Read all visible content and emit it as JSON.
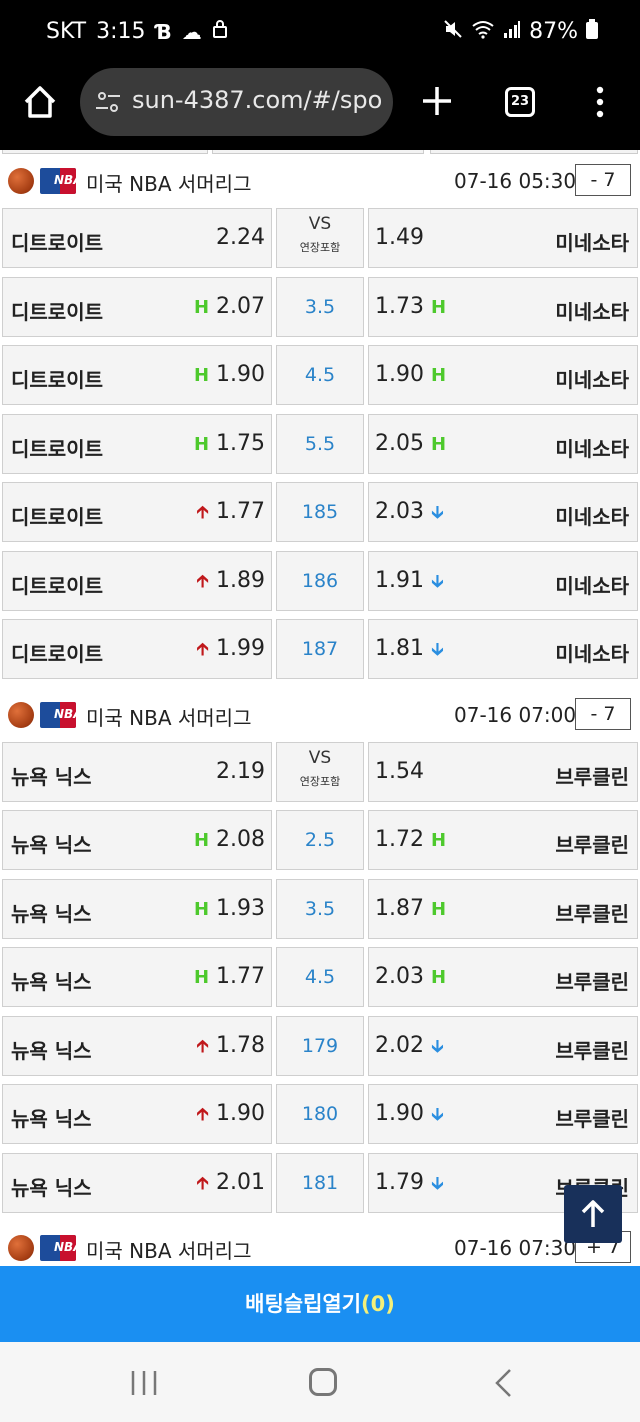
{
  "status_bar": {
    "carrier": "SKT",
    "time": "3:15",
    "battery": "87%",
    "icons": [
      "b-app-icon",
      "cloud-icon",
      "lock-icon",
      "mute-icon",
      "wifi-icon",
      "signal-icon",
      "battery-icon"
    ]
  },
  "browser": {
    "url": "sun-4387.com/#/spo",
    "tab_count": "23"
  },
  "leagues": [
    {
      "name": "미국 NBA 서머리그",
      "time": "07-16 05:30",
      "more": "- 7",
      "vs_label": "VS",
      "vs_sub": "연장포함",
      "rows": [
        {
          "home": "디트로이트",
          "home_odd": "2.24",
          "mid": "VS",
          "away_odd": "1.49",
          "away": "미네소타",
          "type": "moneyline"
        },
        {
          "home": "디트로이트",
          "home_odd": "2.07",
          "mid": "3.5",
          "away_odd": "1.73",
          "away": "미네소타",
          "type": "handicap",
          "marker": "H"
        },
        {
          "home": "디트로이트",
          "home_odd": "1.90",
          "mid": "4.5",
          "away_odd": "1.90",
          "away": "미네소타",
          "type": "handicap",
          "marker": "H"
        },
        {
          "home": "디트로이트",
          "home_odd": "1.75",
          "mid": "5.5",
          "away_odd": "2.05",
          "away": "미네소타",
          "type": "handicap",
          "marker": "H"
        },
        {
          "home": "디트로이트",
          "home_odd": "1.77",
          "mid": "185",
          "away_odd": "2.03",
          "away": "미네소타",
          "type": "overunder"
        },
        {
          "home": "디트로이트",
          "home_odd": "1.89",
          "mid": "186",
          "away_odd": "1.91",
          "away": "미네소타",
          "type": "overunder"
        },
        {
          "home": "디트로이트",
          "home_odd": "1.99",
          "mid": "187",
          "away_odd": "1.81",
          "away": "미네소타",
          "type": "overunder"
        }
      ]
    },
    {
      "name": "미국 NBA 서머리그",
      "time": "07-16 07:00",
      "more": "- 7",
      "vs_label": "VS",
      "vs_sub": "연장포함",
      "rows": [
        {
          "home": "뉴욕 닉스",
          "home_odd": "2.19",
          "mid": "VS",
          "away_odd": "1.54",
          "away": "브루클린",
          "type": "moneyline"
        },
        {
          "home": "뉴욕 닉스",
          "home_odd": "2.08",
          "mid": "2.5",
          "away_odd": "1.72",
          "away": "브루클린",
          "type": "handicap",
          "marker": "H"
        },
        {
          "home": "뉴욕 닉스",
          "home_odd": "1.93",
          "mid": "3.5",
          "away_odd": "1.87",
          "away": "브루클린",
          "type": "handicap",
          "marker": "H"
        },
        {
          "home": "뉴욕 닉스",
          "home_odd": "1.77",
          "mid": "4.5",
          "away_odd": "2.03",
          "away": "브루클린",
          "type": "handicap",
          "marker": "H"
        },
        {
          "home": "뉴욕 닉스",
          "home_odd": "1.78",
          "mid": "179",
          "away_odd": "2.02",
          "away": "브루클린",
          "type": "overunder"
        },
        {
          "home": "뉴욕 닉스",
          "home_odd": "1.90",
          "mid": "180",
          "away_odd": "1.90",
          "away": "브루클린",
          "type": "overunder"
        },
        {
          "home": "뉴욕 닉스",
          "home_odd": "2.01",
          "mid": "181",
          "away_odd": "1.79",
          "away": "브루클린",
          "type": "overunder"
        }
      ]
    },
    {
      "name": "미국 NBA 서머리그",
      "time": "07-16 07:30",
      "more": "+ 7",
      "rows": []
    }
  ],
  "bet_slip": {
    "label": "배팅슬립열기",
    "count": "(0)"
  },
  "colors": {
    "handicap_marker": "#4dc92c",
    "up_arrow": "#c0181b",
    "down_arrow": "#2a8ee0",
    "mid_value": "#2a83c9",
    "bet_bar": "#1a8ff2",
    "scroll_top": "#18305a"
  }
}
